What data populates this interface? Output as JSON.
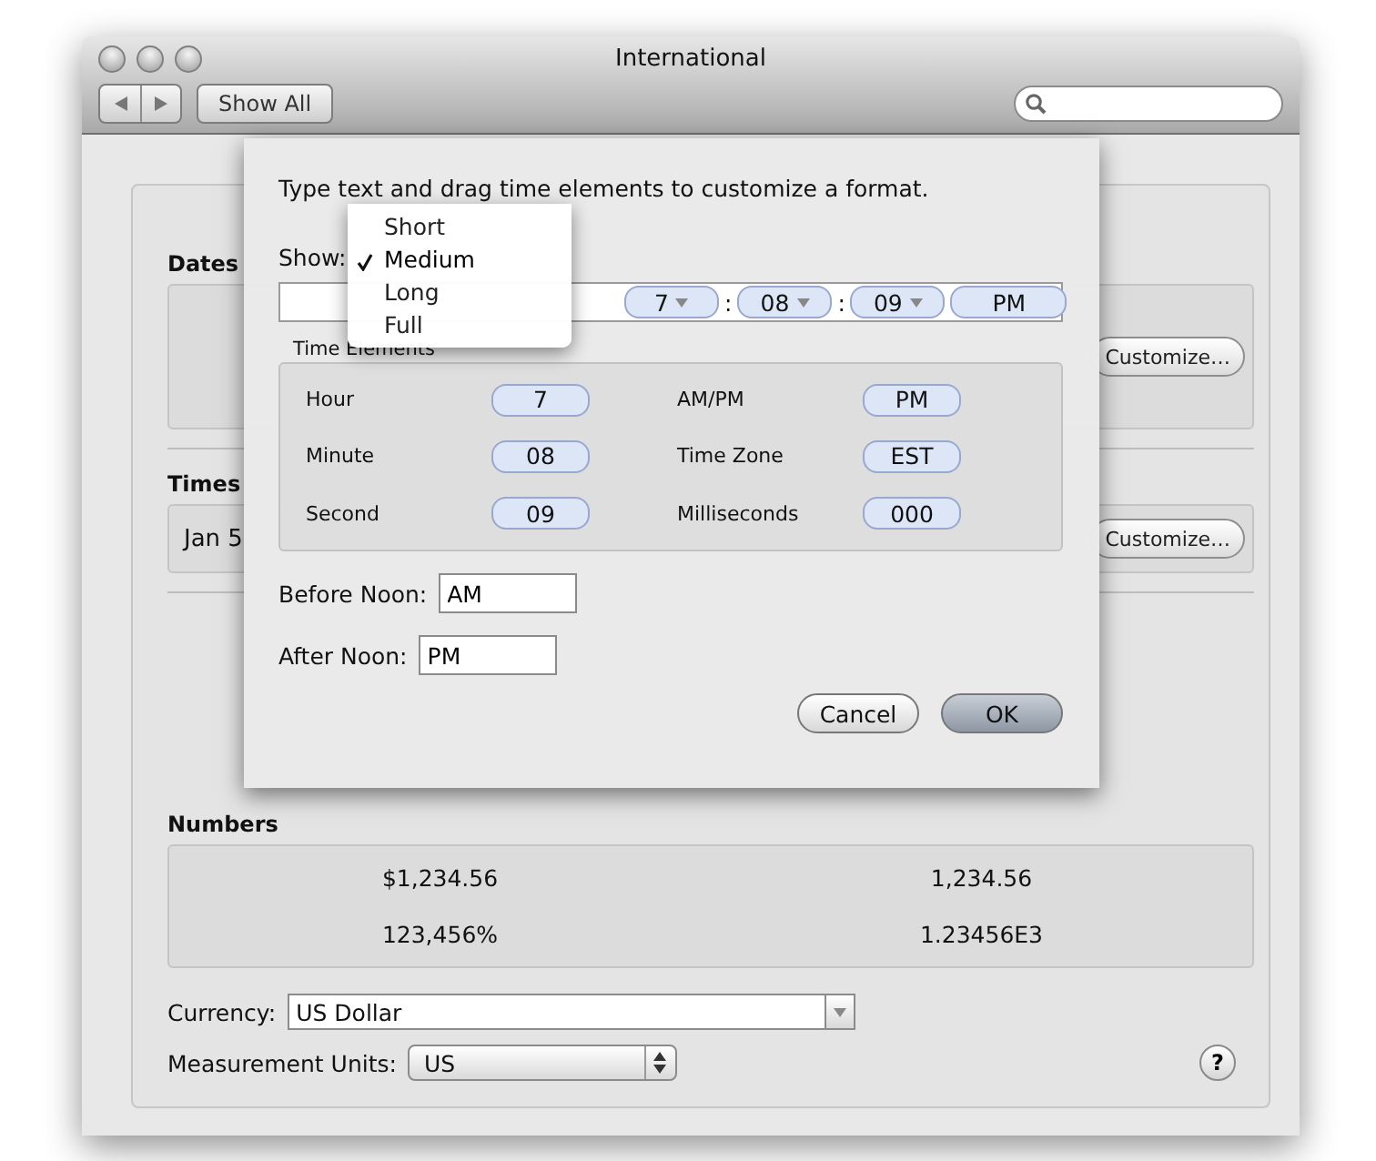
{
  "window": {
    "title": "International",
    "show_all": "Show All"
  },
  "dates": {
    "title": "Dates",
    "customize": "Customize…"
  },
  "times": {
    "title": "Times",
    "sample": "Jan 5",
    "customize": "Customize…"
  },
  "numbers": {
    "title": "Numbers",
    "samples": [
      "$1,234.56",
      "1,234.56",
      "123,456%",
      "1.23456E3"
    ]
  },
  "currency": {
    "label": "Currency:",
    "value": "US Dollar"
  },
  "measurement": {
    "label": "Measurement Units:",
    "value": "US"
  },
  "help": "?",
  "sheet": {
    "instructions": "Type text and drag time elements to customize a format.",
    "show_label": "Show:",
    "menu": [
      {
        "label": "Short",
        "selected": false
      },
      {
        "label": "Medium",
        "selected": true
      },
      {
        "label": "Long",
        "selected": false
      },
      {
        "label": "Full",
        "selected": false
      }
    ],
    "format_tokens": [
      {
        "kind": "menu",
        "text": "7"
      },
      {
        "kind": "separator",
        "text": ":"
      },
      {
        "kind": "menu",
        "text": "08"
      },
      {
        "kind": "separator",
        "text": ":"
      },
      {
        "kind": "menu",
        "text": "09"
      },
      {
        "kind": "plain",
        "text": "PM"
      }
    ],
    "time_elements": {
      "title": "Time Elements",
      "items": [
        {
          "label": "Hour",
          "token": "7"
        },
        {
          "label": "AM/PM",
          "token": "PM"
        },
        {
          "label": "Minute",
          "token": "08"
        },
        {
          "label": "Time Zone",
          "token": "EST"
        },
        {
          "label": "Second",
          "token": "09"
        },
        {
          "label": "Milliseconds",
          "token": "000"
        }
      ]
    },
    "before_noon": {
      "label": "Before Noon:",
      "value": "AM"
    },
    "after_noon": {
      "label": "After Noon:",
      "value": "PM"
    },
    "buttons": [
      {
        "label": "Cancel",
        "default": false
      },
      {
        "label": "OK",
        "default": true
      }
    ]
  }
}
